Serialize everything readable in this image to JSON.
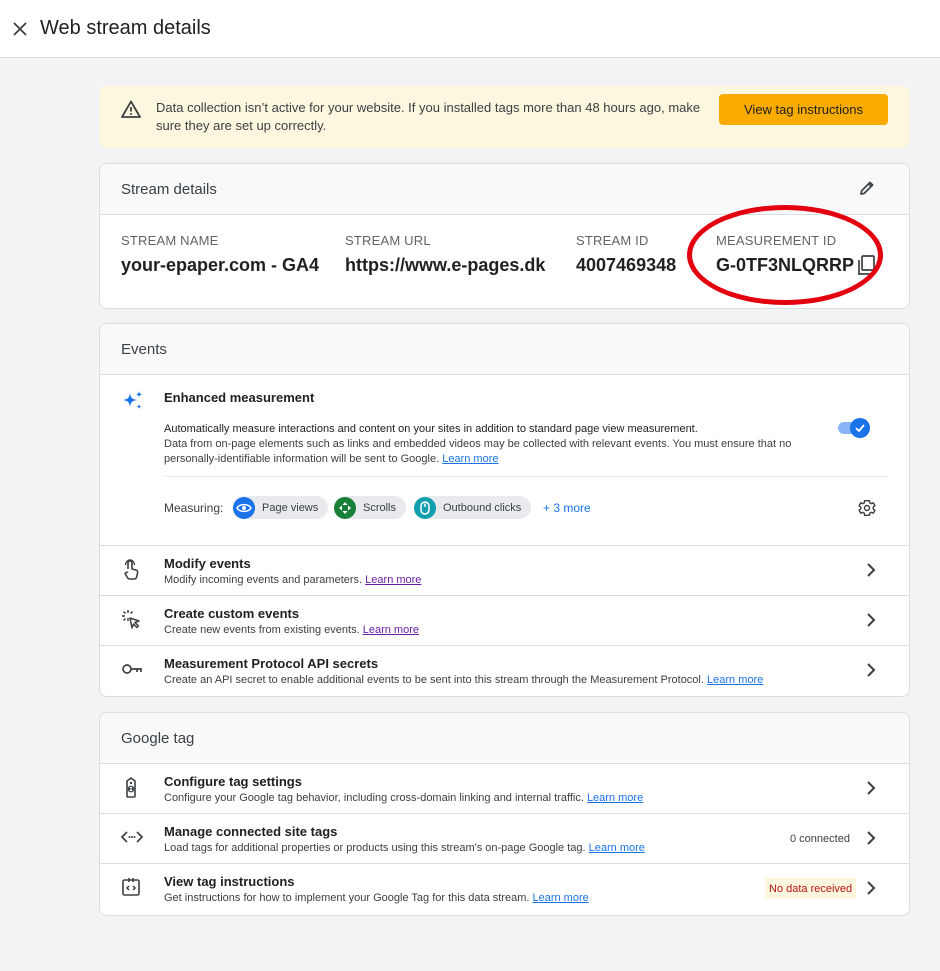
{
  "header": {
    "title": "Web stream details",
    "close_icon": "close-icon"
  },
  "banner": {
    "icon": "warning-icon",
    "text": "Data collection isn’t active for your website. If you installed tags more than 48 hours ago, make sure they are set up correctly.",
    "button_label": "View tag instructions",
    "background": "#fef7e0",
    "button_color": "#f9ab00"
  },
  "stream_details": {
    "title": "Stream details",
    "columns": [
      {
        "label": "STREAM NAME",
        "value": "your-epaper.com - GA4"
      },
      {
        "label": "STREAM URL",
        "value": "https://www.e-pages.dk"
      },
      {
        "label": "STREAM ID",
        "value": "4007469348"
      },
      {
        "label": "MEASUREMENT ID",
        "value": "G-0TF3NLQRRP"
      }
    ]
  },
  "events": {
    "title": "Events",
    "enhanced": {
      "title": "Enhanced measurement",
      "desc_strong": "Automatically measure interactions and content on your sites in addition to standard page view measurement.",
      "desc_rest": "Data from on-page elements such as links and embedded videos may be collected with relevant events. You must ensure that no personally-identifiable information will be sent to Google.",
      "learn_more": "Learn more",
      "enabled": true,
      "measuring_label": "Measuring:",
      "chips": [
        {
          "label": "Page views",
          "icon": "eye-icon",
          "color": "#1a73e8"
        },
        {
          "label": "Scrolls",
          "icon": "scroll-icon",
          "color": "#188038"
        },
        {
          "label": "Outbound clicks",
          "icon": "mouse-icon",
          "color": "#129eaf"
        }
      ],
      "more": "+ 3 more"
    },
    "rows": [
      {
        "title": "Modify events",
        "subtitle": "Modify incoming events and parameters.",
        "link": "Learn more",
        "icon": "touch-icon"
      },
      {
        "title": "Create custom events",
        "subtitle": "Create new events from existing events.",
        "link": "Learn more",
        "icon": "sparkle-cursor-icon"
      },
      {
        "title": "Measurement Protocol API secrets",
        "subtitle": "Create an API secret to enable additional events to be sent into this stream through the Measurement Protocol.",
        "link": "Learn more",
        "icon": "key-icon"
      }
    ]
  },
  "google_tag": {
    "title": "Google tag",
    "rows": [
      {
        "title": "Configure tag settings",
        "subtitle": "Configure your Google tag behavior, including cross-domain linking and internal traffic.",
        "link": "Learn more",
        "icon": "tag-icon"
      },
      {
        "title": "Manage connected site tags",
        "subtitle": "Load tags for additional properties or products using this stream's on-page Google tag.",
        "link": "Learn more",
        "status": "0 connected",
        "icon": "code-arrows-icon"
      },
      {
        "title": "View tag instructions",
        "subtitle": "Get instructions for how to implement your Google Tag for this data stream.",
        "link": "Learn more",
        "status": "No data received",
        "icon": "code-box-icon"
      }
    ]
  },
  "colors": {
    "accent": "#1a73e8",
    "highlight_ellipse": "#e3000f"
  }
}
